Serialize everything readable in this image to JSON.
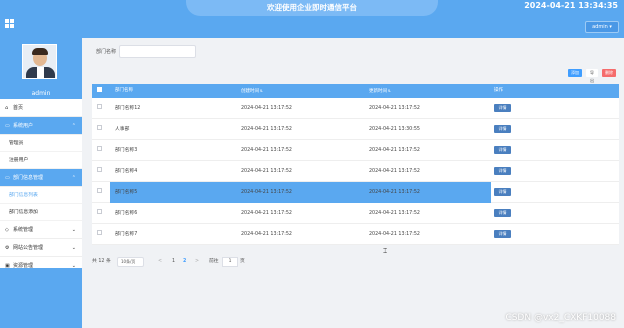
{
  "header": {
    "app_title": "欢迎使用企业即时通信平台",
    "datetime": "2024-04-21 13:34:35",
    "user_button": "admin ▾",
    "menu_icon": "grid-icon"
  },
  "sidebar": {
    "username": "admin",
    "items": [
      {
        "label": "首页",
        "icon": "home-icon"
      },
      {
        "label": "系统用户",
        "icon": "monitor-icon",
        "active": true
      },
      {
        "label": "管理员"
      },
      {
        "label": "注册用户"
      },
      {
        "label": "部门信息管理",
        "icon": "monitor-icon",
        "active": true
      },
      {
        "label": "部门信息列表"
      },
      {
        "label": "部门信息添加"
      },
      {
        "label": "系统管理",
        "icon": "tag-icon"
      },
      {
        "label": "网站公告管理",
        "icon": "gear-icon"
      },
      {
        "label": "资源管理",
        "icon": "folder-icon"
      }
    ]
  },
  "search": {
    "label": "部门名称",
    "value": ""
  },
  "toolbar": {
    "add": "添加",
    "export": "导出",
    "delete": "删除"
  },
  "table": {
    "columns": [
      "部门名称",
      "创建时间",
      "更新时间",
      "操作"
    ],
    "rows": [
      {
        "name": "部门名称12",
        "created": "2024-04-21 13:17:52",
        "updated": "2024-04-21 13:17:52",
        "action": "详情"
      },
      {
        "name": "人事部",
        "created": "2024-04-21 13:17:52",
        "updated": "2024-04-21 13:30:55",
        "action": "详情"
      },
      {
        "name": "部门名称3",
        "created": "2024-04-21 13:17:52",
        "updated": "2024-04-21 13:17:52",
        "action": "详情"
      },
      {
        "name": "部门名称4",
        "created": "2024-04-21 13:17:52",
        "updated": "2024-04-21 13:17:52",
        "action": "详情"
      },
      {
        "name": "部门名称5",
        "created": "2024-04-21 13:17:52",
        "updated": "2024-04-21 13:17:52",
        "action": "详情",
        "highlight": true
      },
      {
        "name": "部门名称6",
        "created": "2024-04-21 13:17:52",
        "updated": "2024-04-21 13:17:52",
        "action": "详情"
      },
      {
        "name": "部门名称7",
        "created": "2024-04-21 13:17:52",
        "updated": "2024-04-21 13:17:52",
        "action": "详情"
      }
    ]
  },
  "pagination": {
    "total": "共 12 条",
    "page_size": "10条/页",
    "prev": "<",
    "pages": [
      "1",
      "2"
    ],
    "current_page": "2",
    "next": ">",
    "goto_label": "前往",
    "goto_value": "1",
    "page_suffix": "页"
  },
  "watermark": "CSDN @vx2_CXKF10088",
  "colors": {
    "primary": "#5aa8f0",
    "link": "#409eff",
    "danger": "#f56c6c",
    "action": "#4a7fbf"
  }
}
